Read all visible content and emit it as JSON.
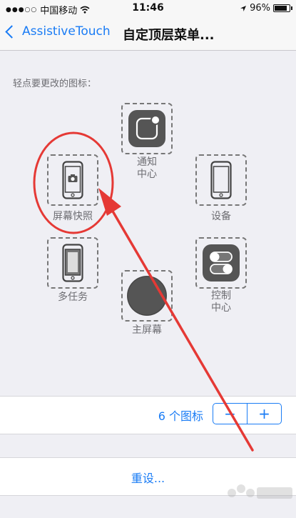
{
  "status_bar": {
    "carrier": "中国移动",
    "time": "11:46",
    "battery": "96%",
    "battery_level": 0.96
  },
  "nav": {
    "back_label": "AssistiveTouch",
    "title": "自定顶层菜单..."
  },
  "section_label": "轻点要更改的图标：",
  "slots": {
    "notification": {
      "label": "通知\n中心",
      "icon": "notification-center-icon"
    },
    "device": {
      "label": "设备",
      "icon": "phone-icon"
    },
    "screenshot": {
      "label": "屏幕快照",
      "icon": "camera-phone-icon"
    },
    "multitask": {
      "label": "多任务",
      "icon": "multitask-icon"
    },
    "control": {
      "label": "控制\n中心",
      "icon": "toggles-icon"
    },
    "home": {
      "label": "主屏幕",
      "icon": "home-button-icon"
    }
  },
  "icon_count": {
    "label": "6 个图标",
    "minus": "−",
    "plus": "+"
  },
  "reset_label": "重设...",
  "colors": {
    "accent": "#1a7cf5",
    "annotation": "#e53935",
    "icon_fill": "#555555"
  }
}
